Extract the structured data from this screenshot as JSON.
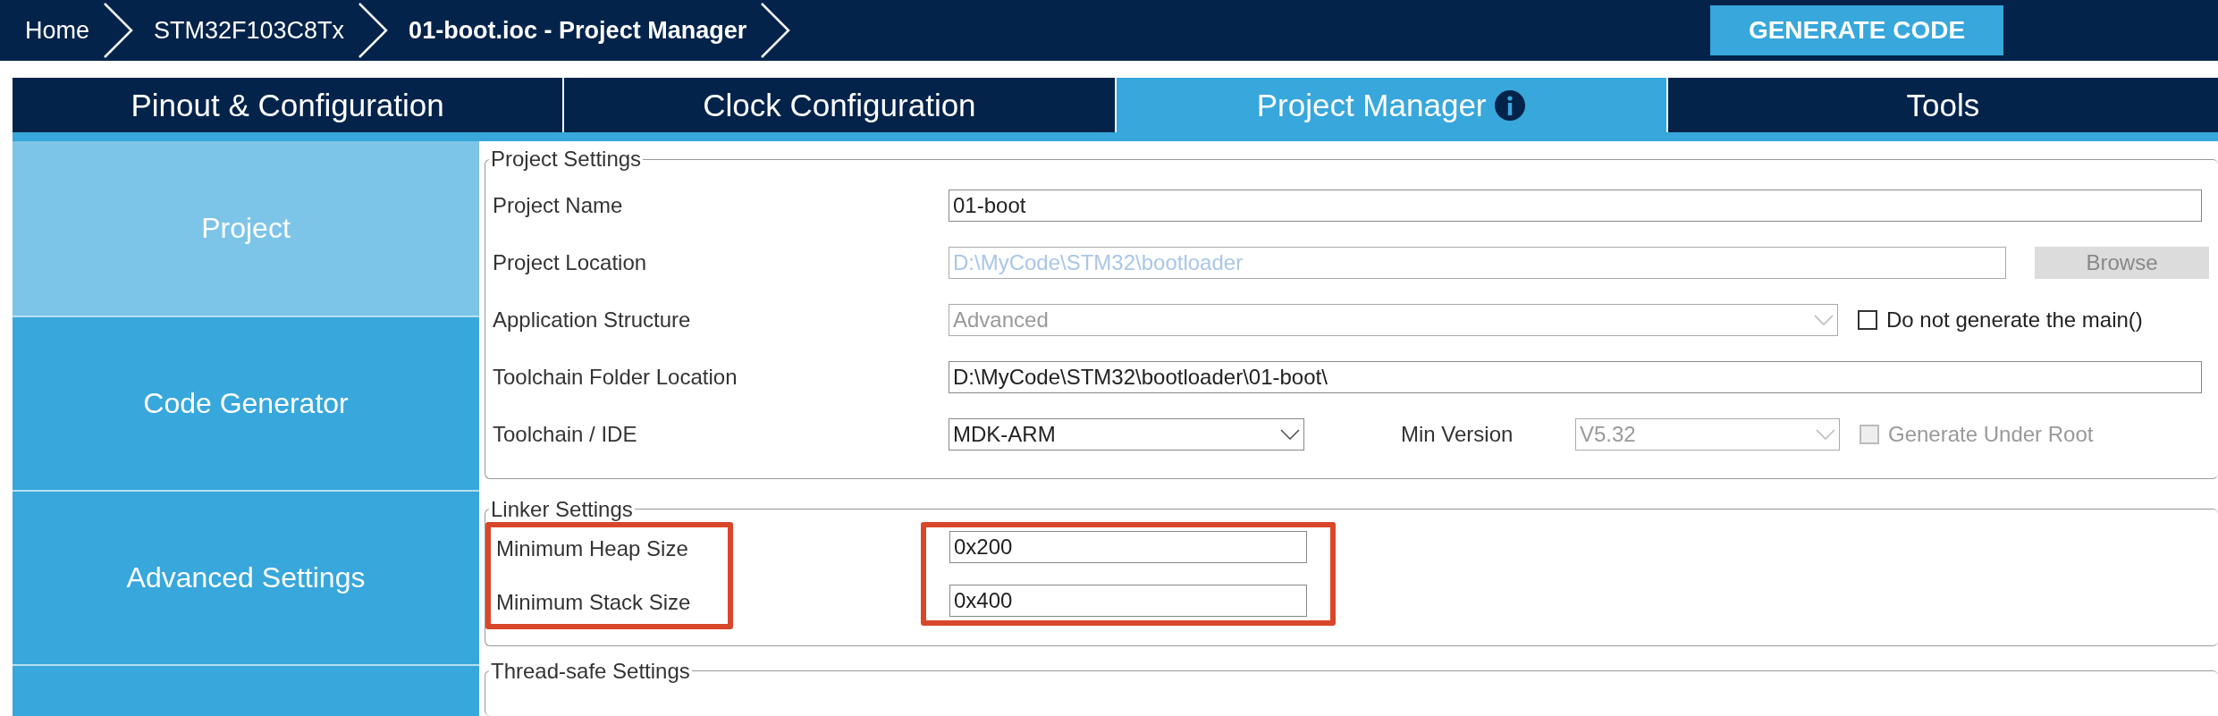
{
  "breadcrumbs": [
    {
      "label": "Home",
      "current": false
    },
    {
      "label": "STM32F103C8Tx",
      "current": false
    },
    {
      "label": "01-boot.ioc - Project Manager",
      "current": true
    }
  ],
  "generate_button": "GENERATE CODE",
  "tabs": [
    {
      "label": "Pinout & Configuration",
      "selected": false,
      "info_icon": false
    },
    {
      "label": "Clock Configuration",
      "selected": false,
      "info_icon": false
    },
    {
      "label": "Project Manager",
      "selected": true,
      "info_icon": true
    },
    {
      "label": "Tools",
      "selected": false,
      "info_icon": false
    }
  ],
  "sidebar": {
    "items": [
      {
        "label": "Project",
        "selected": true
      },
      {
        "label": "Code Generator",
        "selected": false
      },
      {
        "label": "Advanced Settings",
        "selected": false
      }
    ]
  },
  "project_settings": {
    "legend": "Project Settings",
    "rows": [
      {
        "label": "Project Name",
        "field": {
          "kind": "input",
          "value": "01-boot",
          "disabled": false
        }
      },
      {
        "label": "Project Location",
        "field": {
          "kind": "input",
          "value": "D:\\MyCode\\STM32\\bootloader",
          "disabled": true
        },
        "button": {
          "label": "Browse",
          "disabled": true
        }
      },
      {
        "label": "Application Structure",
        "field": {
          "kind": "dropdown",
          "value": "Advanced",
          "disabled": true
        },
        "checkbox": {
          "label": "Do not generate the main()",
          "checked": false,
          "disabled": false
        }
      },
      {
        "label": "Toolchain Folder Location",
        "field": {
          "kind": "input",
          "value": "D:\\MyCode\\STM32\\bootloader\\01-boot\\",
          "disabled": false
        }
      },
      {
        "label": "Toolchain / IDE",
        "field": {
          "kind": "dropdown",
          "value": "MDK-ARM",
          "disabled": false
        },
        "min_version": {
          "label": "Min Version",
          "field": {
            "kind": "dropdown",
            "value": "V5.32",
            "disabled": true
          }
        },
        "checkbox": {
          "label": "Generate Under Root",
          "checked": false,
          "disabled": true
        }
      }
    ]
  },
  "linker_settings": {
    "legend": "Linker Settings",
    "highlighted": true,
    "rows": [
      {
        "label": "Minimum Heap Size",
        "value": "0x200"
      },
      {
        "label": "Minimum Stack Size",
        "value": "0x400"
      }
    ]
  },
  "thread_safe_settings": {
    "legend": "Thread-safe Settings"
  }
}
